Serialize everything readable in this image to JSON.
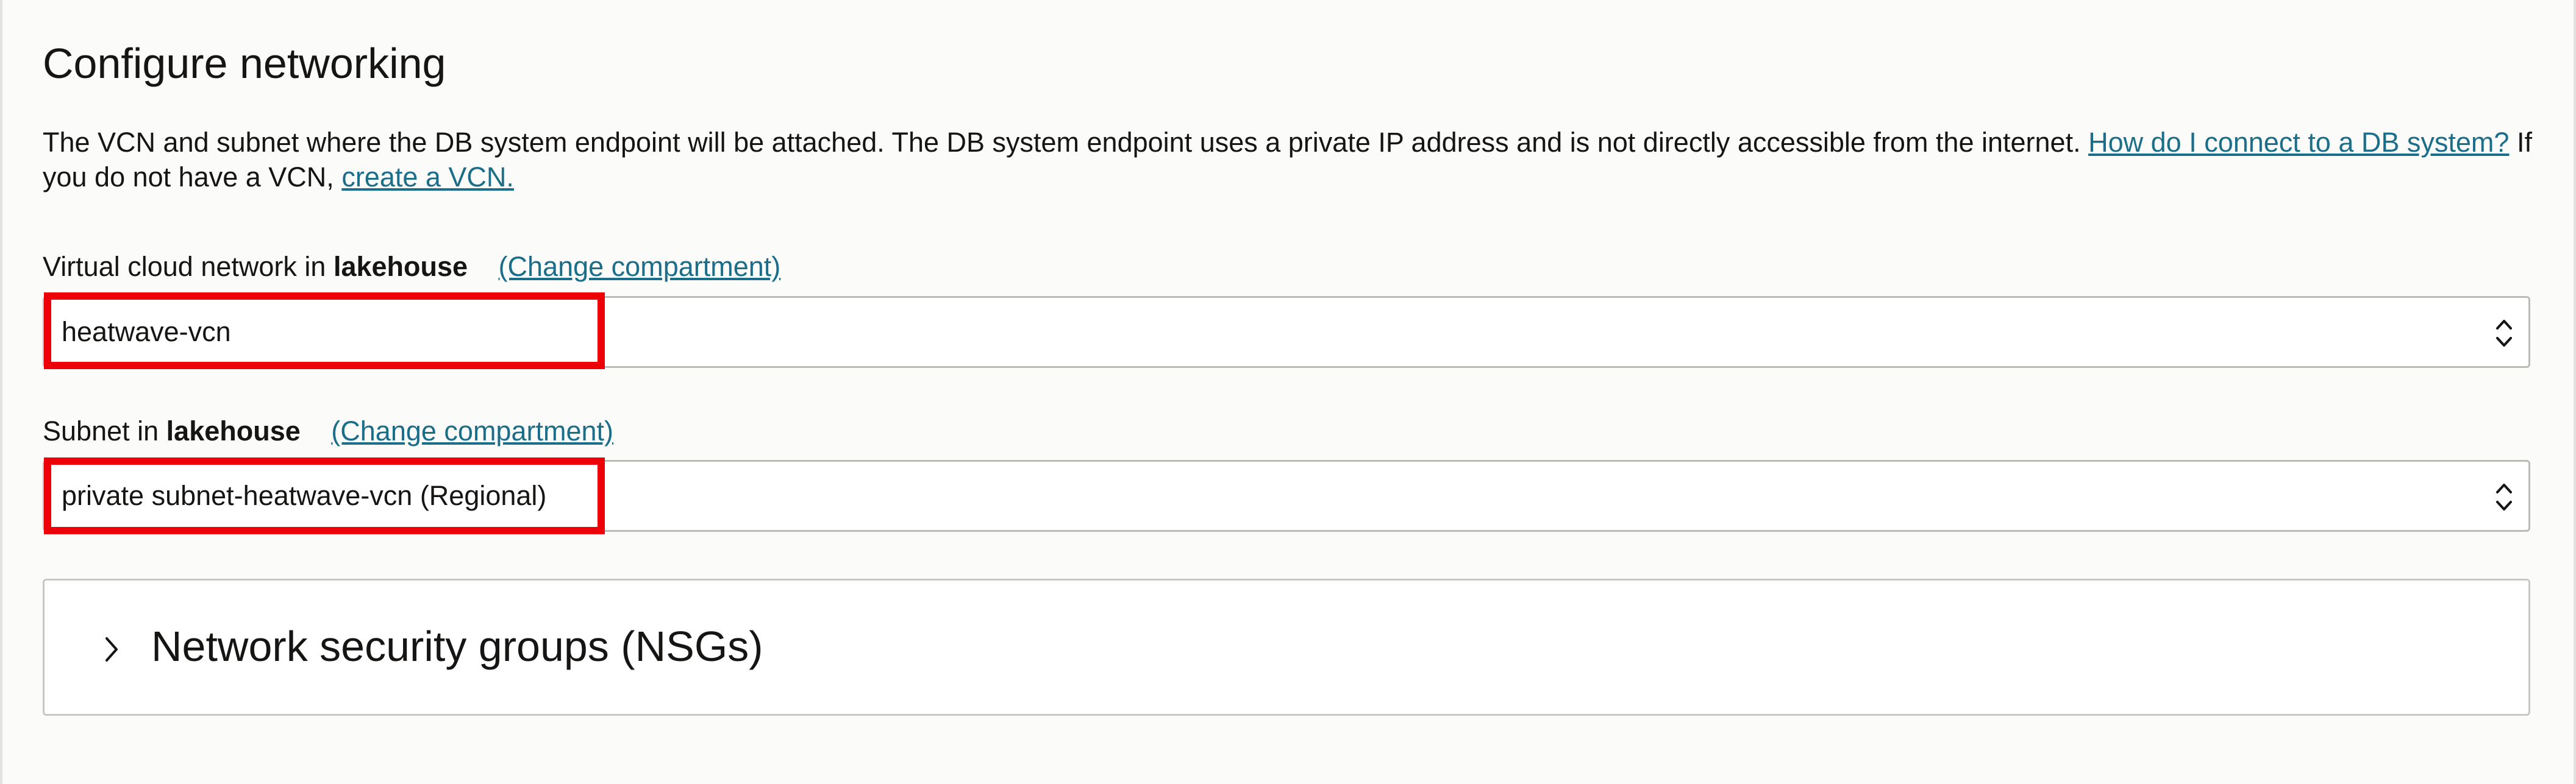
{
  "section": {
    "title": "Configure networking",
    "description_text_1": "The VCN and subnet where the DB system endpoint will be attached. The DB system endpoint uses a private IP address and is not directly accessible from the internet.",
    "help_link": "How do I connect to a DB system?",
    "description_text_2": "If you do not have a VCN,",
    "create_vcn_link": "create a VCN."
  },
  "vcn_field": {
    "label_prefix": "Virtual cloud network in",
    "compartment": "lakehouse",
    "change_link": "(Change compartment)",
    "value": "heatwave-vcn"
  },
  "subnet_field": {
    "label_prefix": "Subnet in",
    "compartment": "lakehouse",
    "change_link": "(Change compartment)",
    "value": "private subnet-heatwave-vcn (Regional)"
  },
  "nsg_section": {
    "title": "Network security groups (NSGs)",
    "expanded": false
  },
  "icons": {
    "select_arrows": "chevron-up-down-icon",
    "nsg_expand": "chevron-right-icon"
  },
  "colors": {
    "link": "#1b6e8a",
    "highlight": "#ee0008",
    "text": "#161513",
    "border": "#bdbbb8"
  }
}
